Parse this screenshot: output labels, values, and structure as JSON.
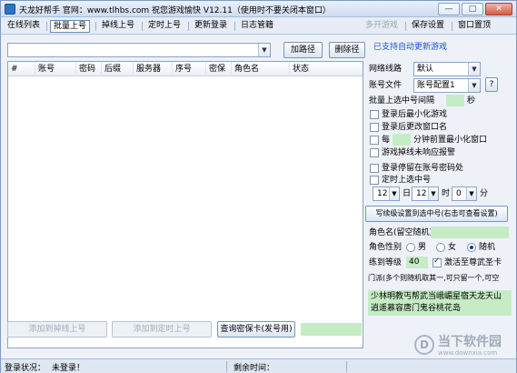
{
  "window": {
    "title": "天龙好帮手  官网：www.tlhbs.com 祝您游戏愉快 V12.11（使用时不要关闭本窗口）",
    "minimize": "—",
    "maximize": "□",
    "close": "✕"
  },
  "menu": {
    "items": [
      "在线列表",
      "批量上号",
      "掉线上号",
      "定时上号",
      "更新登录",
      "日志管籍"
    ],
    "active_index": 1,
    "right_disabled": "多开游戏",
    "right_items": [
      "保存设置",
      "窗口置顶"
    ]
  },
  "toolbar": {
    "path_combo_value": "",
    "add_path": "加路径",
    "delete_path": "删除径",
    "auto_update_note": "已支持自动更新游戏"
  },
  "table": {
    "columns": [
      "#",
      "账号",
      "密码",
      "后缀",
      "服务器",
      "序号",
      "密保",
      "角色名",
      "状态"
    ]
  },
  "settings": {
    "network_label": "网络线路",
    "network_value": "默认",
    "account_file_label": "账号文件",
    "account_file_value": "账号配置1",
    "help_button": "?",
    "interval_label": "批量上选中号间隔",
    "interval_value": "",
    "interval_unit": "秒",
    "opt_minimize": "登录后最小化游戏",
    "opt_rename": "登录后更改窗口名",
    "opt_every_label": "每",
    "opt_every_value": "",
    "opt_every_suffix": "分钟前置最小化窗口",
    "opt_alarm": "游戏掉线未响应报警",
    "opt_stop_on_error": "登录停留在账号密码处",
    "opt_scheduled": "定时上选中号",
    "time_hour": "12",
    "time_day_label": "日",
    "time_hour2": "12",
    "time_hour_label": "时",
    "time_minute": "0",
    "time_minute_label": "分",
    "write_settings_button": "写续级设置到选中号(右击可查看设置)",
    "role_name_label": "角色名(留空随机)",
    "role_name_value": "",
    "gender_label": "角色性别",
    "gender_options": [
      "男",
      "女",
      "随机"
    ],
    "gender_selected": 2,
    "level_label": "练到等级",
    "level_value": "40",
    "activate_label": "激活至尊武圣卡",
    "school_note": "门派(多个则随机取其一,可只留一个,可空",
    "school_list": "少林明教丐帮武当峨嵋星宿天龙天山逍遥慕容唐门鬼谷桃花岛"
  },
  "bottom_buttons": {
    "add_to_offline": "添加到掉线上号",
    "add_to_scheduled": "添加到定时上号",
    "query_security": "查询密保卡(发号用)",
    "query_value": ""
  },
  "status": {
    "login_label": "登录状况：",
    "login_value": "未登录！",
    "remaining_label": "剩余时间："
  },
  "watermark": {
    "logo": "D",
    "main": "当下软件园",
    "sub": "www.downxia.com"
  }
}
